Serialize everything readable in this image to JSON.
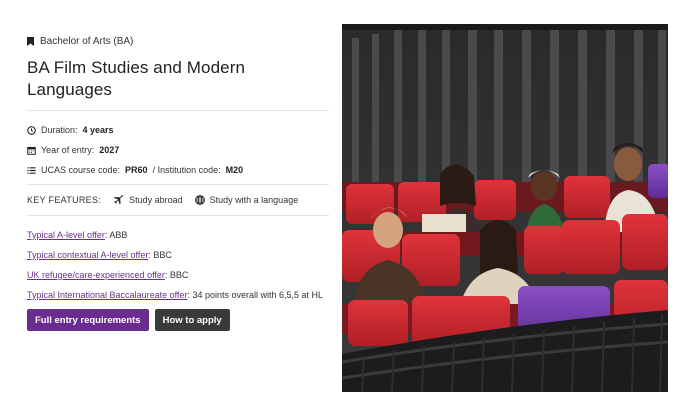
{
  "course": {
    "degree_type": "Bachelor of Arts (BA)",
    "title": "BA Film Studies and Modern Languages"
  },
  "meta": {
    "duration_label": "Duration:",
    "duration_value": "4 years",
    "entry_label": "Year of entry:",
    "entry_value": "2027",
    "ucas_label": "UCAS course code:",
    "ucas_value": "PR60",
    "institution_label": "/ Institution code:",
    "institution_value": "M20"
  },
  "features": {
    "label": "KEY FEATURES:",
    "items": [
      "Study abroad",
      "Study with a language"
    ]
  },
  "offers": [
    {
      "link": "Typical A-level offer",
      "value": ": ABB"
    },
    {
      "link": "Typical contextual A-level offer",
      "value": ": BBC"
    },
    {
      "link": "UK refugee/care-experienced offer",
      "value": ": BBC"
    },
    {
      "link": "Typical International Baccalaureate offer",
      "value": ": 34 points overall with 6,5,5 at HL"
    }
  ],
  "buttons": {
    "entry_requirements": "Full entry requirements",
    "how_to_apply": "How to apply"
  },
  "colors": {
    "accent": "#6b2c8f",
    "link": "#6a2e8c",
    "dark_button": "#3a3a3a"
  },
  "icons": [
    "bookmark-icon",
    "clock-icon",
    "calendar-icon",
    "list-icon",
    "plane-icon",
    "globe-icon"
  ]
}
